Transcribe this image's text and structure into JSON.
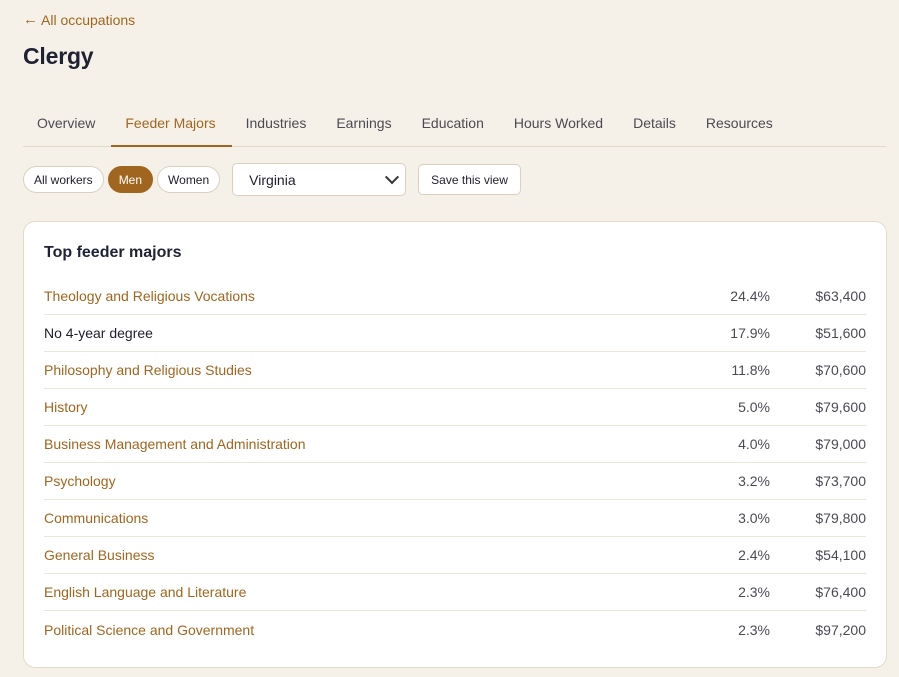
{
  "nav": {
    "back_arrow": "←",
    "back_label": "All occupations"
  },
  "page": {
    "title": "Clergy"
  },
  "tabs": [
    {
      "label": "Overview",
      "active": false
    },
    {
      "label": "Feeder Majors",
      "active": true
    },
    {
      "label": "Industries",
      "active": false
    },
    {
      "label": "Earnings",
      "active": false
    },
    {
      "label": "Education",
      "active": false
    },
    {
      "label": "Hours Worked",
      "active": false
    },
    {
      "label": "Details",
      "active": false
    },
    {
      "label": "Resources",
      "active": false
    }
  ],
  "filters": {
    "segments": [
      {
        "label": "All workers",
        "active": false
      },
      {
        "label": "Men",
        "active": true
      },
      {
        "label": "Women",
        "active": false
      }
    ],
    "state_select": {
      "selected": "Virginia"
    },
    "save_label": "Save this view"
  },
  "card": {
    "title": "Top feeder majors",
    "rows": [
      {
        "major": "Theology and Religious Vocations",
        "share": "24.4%",
        "earnings": "$63,400",
        "link": true
      },
      {
        "major": "No 4-year degree",
        "share": "17.9%",
        "earnings": "$51,600",
        "link": false
      },
      {
        "major": "Philosophy and Religious Studies",
        "share": "11.8%",
        "earnings": "$70,600",
        "link": true
      },
      {
        "major": "History",
        "share": "5.0%",
        "earnings": "$79,600",
        "link": true
      },
      {
        "major": "Business Management and Administration",
        "share": "4.0%",
        "earnings": "$79,000",
        "link": true
      },
      {
        "major": "Psychology",
        "share": "3.2%",
        "earnings": "$73,700",
        "link": true
      },
      {
        "major": "Communications",
        "share": "3.0%",
        "earnings": "$79,800",
        "link": true
      },
      {
        "major": "General Business",
        "share": "2.4%",
        "earnings": "$54,100",
        "link": true
      },
      {
        "major": "English Language and Literature",
        "share": "2.3%",
        "earnings": "$76,400",
        "link": true
      },
      {
        "major": "Political Science and Government",
        "share": "2.3%",
        "earnings": "$97,200",
        "link": true
      }
    ]
  },
  "colors": {
    "accent": "#a0661f",
    "background": "#f6f1e8",
    "text": "#1f1d2b"
  }
}
